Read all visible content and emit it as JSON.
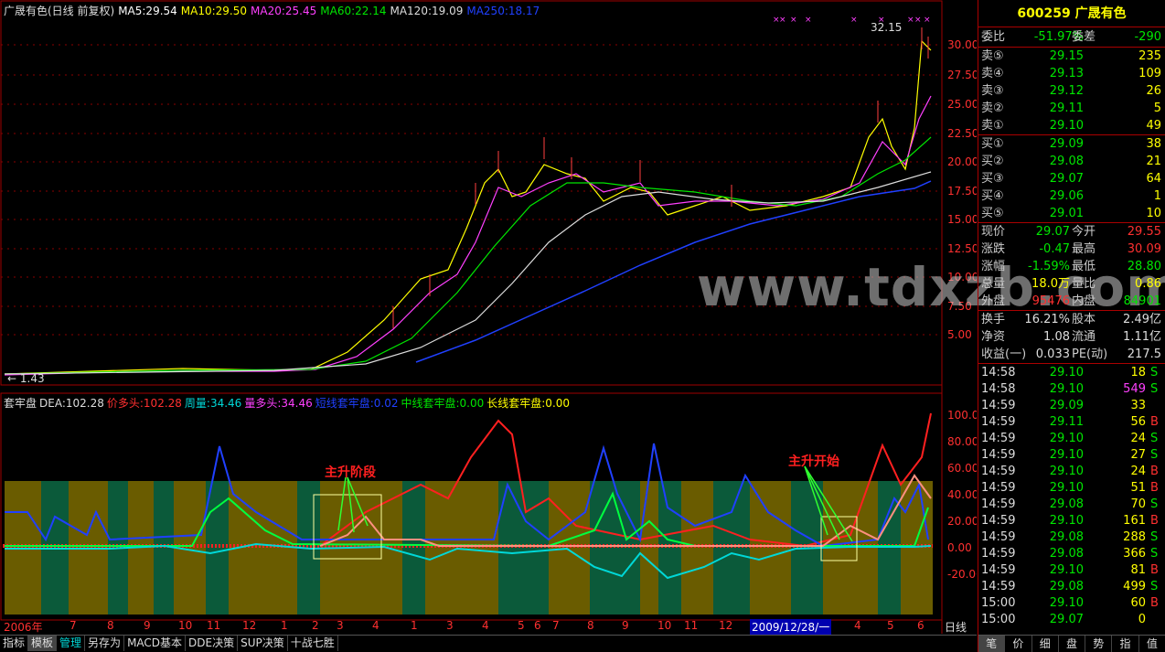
{
  "main_legend": [
    {
      "text": "广晟有色(日线 前复权)",
      "color": "#dddddd"
    },
    {
      "text": "MA5:29.54",
      "color": "#ffffff"
    },
    {
      "text": "MA10:29.50",
      "color": "#ffff00"
    },
    {
      "text": "MA20:25.45",
      "color": "#ff40ff"
    },
    {
      "text": "MA60:22.14",
      "color": "#00e600"
    },
    {
      "text": "MA120:19.09",
      "color": "#dddddd"
    },
    {
      "text": "MA250:18.17",
      "color": "#2040ff"
    }
  ],
  "price_axis": [
    "30.00",
    "27.50",
    "25.00",
    "22.50",
    "20.00",
    "17.50",
    "15.00",
    "12.50",
    "10.00",
    "7.50",
    "5.00"
  ],
  "price_high_label": "32.15",
  "price_low_label": "← 1.43",
  "indicator_legend": [
    {
      "text": "套牢盘",
      "color": "#dddddd"
    },
    {
      "text": "DEA:102.28",
      "color": "#dddddd"
    },
    {
      "text": "价多头:102.28",
      "color": "#ff3030"
    },
    {
      "text": "周量:34.46",
      "color": "#00d8d8"
    },
    {
      "text": "量多头:34.46",
      "color": "#ff40ff"
    },
    {
      "text": "短线套牢盘:0.02",
      "color": "#2040ff"
    },
    {
      "text": "中线套牢盘:0.00",
      "color": "#00e600"
    },
    {
      "text": "长线套牢盘:0.00",
      "color": "#ffff00"
    }
  ],
  "indicator_axis": [
    "100.00",
    "80.00",
    "60.00",
    "40.00",
    "20.00",
    "0.00",
    "-20.00"
  ],
  "annotations": {
    "phase1": "主升阶段",
    "phase2": "主升开始"
  },
  "watermark": "www.tdxzb.com",
  "date_axis": [
    {
      "label": "2006年",
      "pos": 4
    },
    {
      "label": "7",
      "pos": 76
    },
    {
      "label": "8",
      "pos": 117
    },
    {
      "label": "9",
      "pos": 157
    },
    {
      "label": "10",
      "pos": 195
    },
    {
      "label": "11",
      "pos": 226
    },
    {
      "label": "12",
      "pos": 265
    },
    {
      "label": "1",
      "pos": 307
    },
    {
      "label": "2",
      "pos": 341
    },
    {
      "label": "3",
      "pos": 368
    },
    {
      "label": "4",
      "pos": 407
    },
    {
      "label": "1",
      "pos": 449
    },
    {
      "label": "3",
      "pos": 488
    },
    {
      "label": "4",
      "pos": 527
    },
    {
      "label": "5",
      "pos": 566
    },
    {
      "label": "6",
      "pos": 584
    },
    {
      "label": "7",
      "pos": 604
    },
    {
      "label": "8",
      "pos": 642
    },
    {
      "label": "9",
      "pos": 680
    },
    {
      "label": "10",
      "pos": 719
    },
    {
      "label": "11",
      "pos": 748
    },
    {
      "label": "12",
      "pos": 786
    },
    {
      "label": "2009/12/28/一",
      "pos": 820
    },
    {
      "label": "4",
      "pos": 934
    },
    {
      "label": "5",
      "pos": 970
    },
    {
      "label": "6",
      "pos": 1003
    }
  ],
  "period_label": "日线",
  "bottom_tabs": [
    {
      "label": "指标",
      "active": false,
      "color": ""
    },
    {
      "label": "模板",
      "active": true,
      "color": ""
    },
    {
      "label": "管理",
      "active": false,
      "color": "cyan"
    },
    {
      "label": "另存为",
      "active": false,
      "color": ""
    },
    {
      "label": "MACD基本",
      "active": false,
      "color": ""
    },
    {
      "label": "DDE决策",
      "active": false,
      "color": ""
    },
    {
      "label": "SUP决策",
      "active": false,
      "color": ""
    },
    {
      "label": "十战七胜",
      "active": false,
      "color": ""
    }
  ],
  "quote": {
    "code": "600259",
    "name": "广晟有色",
    "weibi_label": "委比",
    "weibi": "-51.97%",
    "weicha_label": "委差",
    "weicha": "-290",
    "asks": [
      {
        "label": "卖⑤",
        "price": "29.15",
        "vol": "235"
      },
      {
        "label": "卖④",
        "price": "29.13",
        "vol": "109"
      },
      {
        "label": "卖③",
        "price": "29.12",
        "vol": "26"
      },
      {
        "label": "卖②",
        "price": "29.11",
        "vol": "5"
      },
      {
        "label": "卖①",
        "price": "29.10",
        "vol": "49"
      }
    ],
    "bids": [
      {
        "label": "买①",
        "price": "29.09",
        "vol": "38"
      },
      {
        "label": "买②",
        "price": "29.08",
        "vol": "21"
      },
      {
        "label": "买③",
        "price": "29.07",
        "vol": "64"
      },
      {
        "label": "买④",
        "price": "29.06",
        "vol": "1"
      },
      {
        "label": "买⑤",
        "price": "29.01",
        "vol": "10"
      }
    ],
    "stats": [
      {
        "l1": "现价",
        "v1": "29.07",
        "c1": "green",
        "l2": "今开",
        "v2": "29.55",
        "c2": "red"
      },
      {
        "l1": "涨跌",
        "v1": "-0.47",
        "c1": "green",
        "l2": "最高",
        "v2": "30.09",
        "c2": "red"
      },
      {
        "l1": "涨幅",
        "v1": "-1.59%",
        "c1": "green",
        "l2": "最低",
        "v2": "28.80",
        "c2": "green"
      },
      {
        "l1": "总量",
        "v1": "18.0万",
        "c1": "yellow",
        "l2": "量比",
        "v2": "0.86",
        "c2": "yellow"
      },
      {
        "l1": "外盘",
        "v1": "95476",
        "c1": "red",
        "l2": "内盘",
        "v2": "84901",
        "c2": "green"
      }
    ],
    "finance": [
      {
        "l1": "换手",
        "v1": "16.21%",
        "l2": "股本",
        "v2": "2.49亿"
      },
      {
        "l1": "净资",
        "v1": "1.08",
        "l2": "流通",
        "v2": "1.11亿"
      },
      {
        "l1": "收益(一)",
        "v1": "0.033",
        "l2": "PE(动)",
        "v2": "217.5"
      }
    ],
    "ticks": [
      {
        "t": "14:58",
        "p": "29.10",
        "v": "18",
        "s": "S",
        "pc": "green",
        "vc": "yellow"
      },
      {
        "t": "14:58",
        "p": "29.10",
        "v": "549",
        "s": "S",
        "pc": "green",
        "vc": "magenta"
      },
      {
        "t": "14:59",
        "p": "29.09",
        "v": "33",
        "s": "",
        "pc": "green",
        "vc": "yellow"
      },
      {
        "t": "14:59",
        "p": "29.11",
        "v": "56",
        "s": "B",
        "pc": "green",
        "vc": "yellow"
      },
      {
        "t": "14:59",
        "p": "29.10",
        "v": "24",
        "s": "S",
        "pc": "green",
        "vc": "yellow"
      },
      {
        "t": "14:59",
        "p": "29.10",
        "v": "27",
        "s": "S",
        "pc": "green",
        "vc": "yellow"
      },
      {
        "t": "14:59",
        "p": "29.10",
        "v": "24",
        "s": "B",
        "pc": "green",
        "vc": "yellow"
      },
      {
        "t": "14:59",
        "p": "29.10",
        "v": "51",
        "s": "B",
        "pc": "green",
        "vc": "yellow"
      },
      {
        "t": "14:59",
        "p": "29.08",
        "v": "70",
        "s": "S",
        "pc": "green",
        "vc": "yellow"
      },
      {
        "t": "14:59",
        "p": "29.10",
        "v": "161",
        "s": "B",
        "pc": "green",
        "vc": "yellow"
      },
      {
        "t": "14:59",
        "p": "29.08",
        "v": "288",
        "s": "S",
        "pc": "green",
        "vc": "yellow"
      },
      {
        "t": "14:59",
        "p": "29.08",
        "v": "366",
        "s": "S",
        "pc": "green",
        "vc": "yellow"
      },
      {
        "t": "14:59",
        "p": "29.10",
        "v": "81",
        "s": "B",
        "pc": "green",
        "vc": "yellow"
      },
      {
        "t": "14:59",
        "p": "29.08",
        "v": "499",
        "s": "S",
        "pc": "green",
        "vc": "yellow"
      },
      {
        "t": "15:00",
        "p": "29.10",
        "v": "60",
        "s": "B",
        "pc": "green",
        "vc": "yellow"
      },
      {
        "t": "15:00",
        "p": "29.07",
        "v": "0",
        "s": "",
        "pc": "green",
        "vc": "yellow"
      }
    ],
    "tabs": [
      "笔",
      "价",
      "细",
      "盘",
      "势",
      "指",
      "值"
    ]
  }
}
